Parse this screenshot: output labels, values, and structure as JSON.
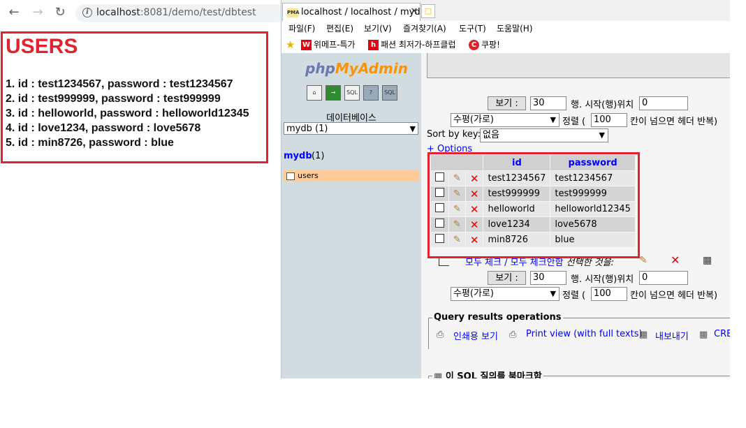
{
  "browser": {
    "url_host": "localhost",
    "url_path": ":8081/demo/test/dbtest"
  },
  "users_panel": {
    "title": "USERS",
    "items": [
      "1. id : test1234567, password : test1234567",
      "2. id : test999999, password : test999999",
      "3. id : helloworld, password : helloworld12345",
      "4. id : love1234, password : love5678",
      "5. id : min8726, password : blue"
    ]
  },
  "ie": {
    "tab_title": "localhost / localhost / myd...",
    "tab_icon_text": "PMA",
    "menu": [
      "파일(F)",
      "편집(E)",
      "보기(V)",
      "즐겨찾기(A)",
      "도구(T)",
      "도움말(H)"
    ],
    "favorites": [
      {
        "label": "위메프-특가",
        "icon": "W",
        "color": "#e60012"
      },
      {
        "label": "패션 최저가-하프클럽",
        "icon": "h",
        "color": "#e60012"
      },
      {
        "label": "쿠팡!",
        "icon": "C",
        "color": "#d9252a"
      }
    ]
  },
  "pma_nav": {
    "logo_php": "php",
    "logo_myadmin": "MyAdmin",
    "icons": [
      "home-icon",
      "exit-icon",
      "sql-icon",
      "help-icon",
      "docs-icon"
    ],
    "db_label": "데이터베이스",
    "db_selected": "mydb (1)",
    "db_link": "mydb",
    "db_count": "(1)",
    "table_item": "users"
  },
  "pma_main": {
    "show_button": "보기 :",
    "rows_value": "30",
    "start_row_label": "행. 시작(행)위치",
    "start_row_value": "0",
    "mode_selected": "수평(가로)",
    "sort_label": "정렬 (",
    "repeat_value": "100",
    "repeat_label": "칸이 넘으면 헤더 반복)",
    "sort_by_key_label": "Sort by key:",
    "sort_by_key_value": "없음",
    "options_link": "+ Options",
    "columns": [
      "id",
      "password"
    ],
    "rows": [
      [
        "test1234567",
        "test1234567"
      ],
      [
        "test999999",
        "test999999"
      ],
      [
        "helloworld",
        "helloworld12345"
      ],
      [
        "love1234",
        "love5678"
      ],
      [
        "min8726",
        "blue"
      ]
    ],
    "check_all": "모두 체크 / 모두 체크안함",
    "with_selected": "선택한 것을:",
    "qro_legend": "Query results operations",
    "qro_print": "인쇄용 보기",
    "qro_print_full": "Print view (with full texts)",
    "qro_export": "내보내기",
    "qro_create": "CRE",
    "bookmark_legend": "이 SQL 질의를 북마크함"
  }
}
